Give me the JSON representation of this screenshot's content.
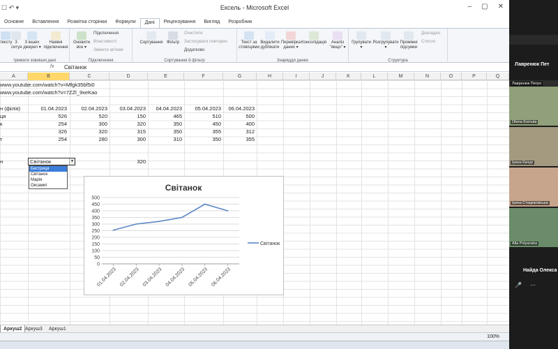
{
  "window": {
    "title": "Ексель - Microsoft Excel",
    "qat": "☐ ↶ ▾",
    "controls": [
      "–",
      "▢",
      "✕"
    ]
  },
  "tabs": [
    "Основне",
    "Вставлення",
    "Розмітка сторінки",
    "Формули",
    "Дані",
    "Рецензування",
    "Вигляд",
    "Розробник"
  ],
  "active_tab": "Дані",
  "ribbon": {
    "ext_data": {
      "b1": "3",
      "b1b": "тексту",
      "b2": "3",
      "b2b": "ситуя",
      "b3": "3 інших",
      "b3b": "джерел ▾",
      "b4": "Наявні",
      "b4b": "підключення",
      "label": "тримати зовнішні дані"
    },
    "connections": {
      "refresh": "Оновити",
      "refresh2": "все ▾",
      "s1": "Підключення",
      "s2": "Властивості",
      "s3": "Змінити зв'язки",
      "label": "Підключення"
    },
    "sort": {
      "sort": "Сортування",
      "filter": "Фільтр",
      "s1": "Очистити",
      "s2": "Застосувати повторно",
      "s3": "Додатково",
      "label": "Сортування й фільтр"
    },
    "datatools": {
      "b1": "Текст за",
      "b1b": "стовпцями",
      "b2": "Видалити",
      "b2b": "дублікати",
      "b3": "Перевірка",
      "b3b": "даних ▾",
      "b4": "Консолідація",
      "b5": "Аналіз",
      "b5b": "\"якщо\" ▾",
      "label": "Знаряддя даних"
    },
    "outline": {
      "b1": "Групувати",
      "b1b": "▾",
      "b2": "Розгрупувати",
      "b2b": "▾",
      "b3": "Проміжні",
      "b3b": "підсумки",
      "s1": "Докладно",
      "s2": "Стисло",
      "label": "Структура"
    }
  },
  "formula_bar": {
    "fx": "fx",
    "value": "Світанок"
  },
  "columns": [
    "A",
    "B",
    "C",
    "D",
    "E",
    "F",
    "G",
    "H",
    "I",
    "J",
    "K",
    "L",
    "M",
    "N",
    "O",
    "P",
    "Q"
  ],
  "selected_column": "B",
  "sheet": {
    "link1": "www.youtube.com/watch?v=Mfgk35bf5i0",
    "link2": "www.youtube.com/watch?v=7ZZl_9xeKao",
    "header_label": "н (філія)",
    "dates": [
      "01.04.2023",
      "02.04.2023",
      "03.04.2023",
      "04.04.2023",
      "05.04.2023",
      "06.04.2023"
    ],
    "rows": [
      {
        "label": "ця",
        "values": [
          "526",
          "520",
          "150",
          "465",
          "510",
          "500"
        ]
      },
      {
        "label": "к",
        "values": [
          "254",
          "300",
          "320",
          "350",
          "450",
          "400"
        ]
      },
      {
        "label": "",
        "values": [
          "326",
          "320",
          "315",
          "350",
          "355",
          "312"
        ]
      },
      {
        "label": "т",
        "values": [
          "254",
          "280",
          "300",
          "310",
          "350",
          "355"
        ]
      }
    ],
    "select_label": "н",
    "select_value": "Світанок",
    "select_result": "320",
    "dropdown_options": [
      "Бистриця",
      "Світанок",
      "Марія",
      "Оксамит"
    ],
    "dropdown_highlight": 0
  },
  "chart_data": {
    "type": "line",
    "title": "Світанок",
    "categories": [
      "01.04.2023",
      "02.04.2023",
      "03.04.2023",
      "04.04.2023",
      "05.04.2023",
      "06.04.2023"
    ],
    "series": [
      {
        "name": "Світанок",
        "values": [
          254,
          300,
          320,
          350,
          450,
          400
        ],
        "color": "#5b86c5"
      }
    ],
    "ylim": [
      0,
      500
    ],
    "yticks": [
      0,
      50,
      100,
      150,
      200,
      250,
      300,
      350,
      400,
      450,
      500
    ],
    "grid": true,
    "legend": "right"
  },
  "sheet_tabs": [
    "Аркуш2",
    "Аркуш3",
    "Аркуш1"
  ],
  "active_sheet": "Аркуш2",
  "statusbar": {
    "zoom": "100%"
  },
  "zoom_panel": {
    "header": "Лавренюк Пет",
    "participants": [
      {
        "name": "Лавренюк Петро",
        "muted": true,
        "color": "#2e2e2e"
      },
      {
        "name": "Olena Kornuta",
        "muted": false,
        "color": "#8fa07a"
      },
      {
        "name": "Ірина Качур",
        "muted": true,
        "color": "#a39a80"
      },
      {
        "name": "Ірина Стацюковська",
        "muted": false,
        "color": "#c7a58d"
      },
      {
        "name": "Alla Polyanska",
        "muted": false,
        "color": "#6a8c6a"
      }
    ],
    "footer": "Найда  Олекса"
  }
}
